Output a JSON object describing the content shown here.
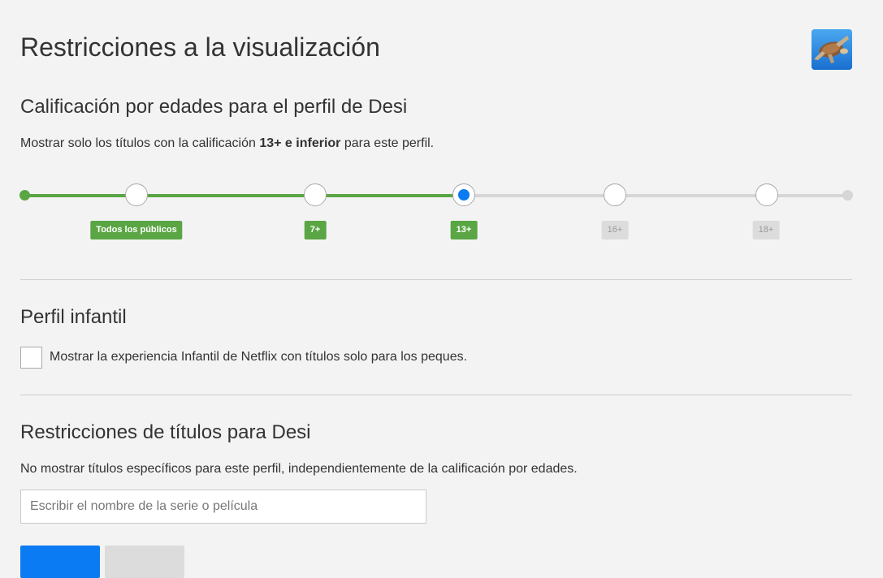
{
  "page": {
    "title": "Restricciones a la visualización"
  },
  "maturity": {
    "heading": "Calificación por edades para el perfil de Desi",
    "desc_before": "Mostrar solo los títulos con la calificación ",
    "desc_bold": "13+ e inferior",
    "desc_after": " para este perfil.",
    "selected": "13+",
    "levels": [
      {
        "label": "Todos los públicos",
        "active": true
      },
      {
        "label": "7+",
        "active": true
      },
      {
        "label": "13+",
        "active": true
      },
      {
        "label": "16+",
        "active": false
      },
      {
        "label": "18+",
        "active": false
      }
    ],
    "colors": {
      "active": "#5aa544",
      "inactive": "#d6d6d6",
      "selected_knob": "#0a7bf2"
    }
  },
  "kids": {
    "heading": "Perfil infantil",
    "checkbox_label": "Mostrar la experiencia Infantil de Netflix con títulos solo para los peques.",
    "checked": false
  },
  "title_restrictions": {
    "heading": "Restricciones de títulos para Desi",
    "desc": "No mostrar títulos específicos para este perfil, independientemente de la calificación por edades.",
    "search_placeholder": "Escribir el nombre de la serie o película"
  },
  "icons": {
    "avatar": "turtle-avatar-icon"
  }
}
